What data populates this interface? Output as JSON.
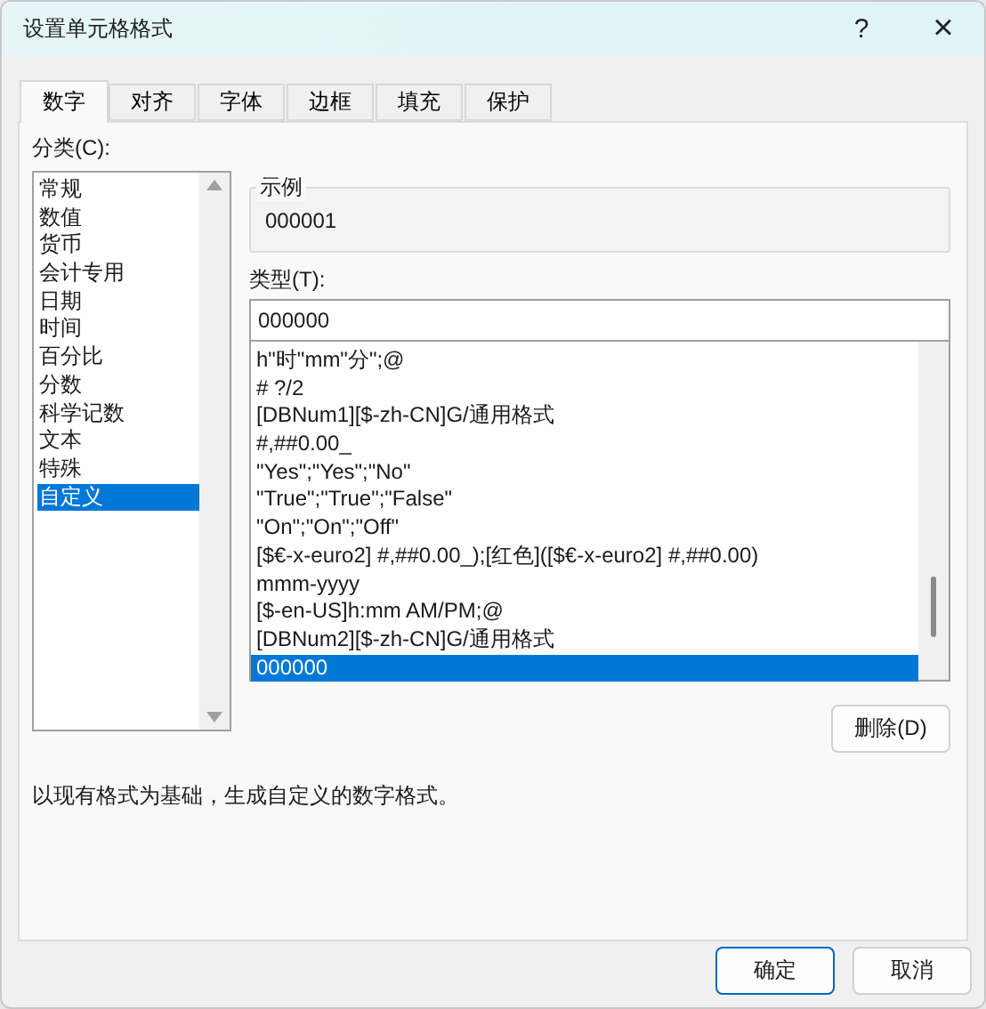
{
  "window": {
    "title": "设置单元格格式",
    "help": "?",
    "close": "×"
  },
  "tabs": [
    {
      "label": "数字",
      "selected": true
    },
    {
      "label": "对齐",
      "selected": false
    },
    {
      "label": "字体",
      "selected": false
    },
    {
      "label": "边框",
      "selected": false
    },
    {
      "label": "填充",
      "selected": false
    },
    {
      "label": "保护",
      "selected": false
    }
  ],
  "category": {
    "label": "分类(C):",
    "items": [
      {
        "label": "常规",
        "selected": false
      },
      {
        "label": "数值",
        "selected": false
      },
      {
        "label": "货币",
        "selected": false
      },
      {
        "label": "会计专用",
        "selected": false
      },
      {
        "label": "日期",
        "selected": false
      },
      {
        "label": "时间",
        "selected": false
      },
      {
        "label": "百分比",
        "selected": false
      },
      {
        "label": "分数",
        "selected": false
      },
      {
        "label": "科学记数",
        "selected": false
      },
      {
        "label": "文本",
        "selected": false
      },
      {
        "label": "特殊",
        "selected": false
      },
      {
        "label": "自定义",
        "selected": true
      }
    ]
  },
  "sample": {
    "label": "示例",
    "value": "000001"
  },
  "type": {
    "label": "类型(T):",
    "value": "000000",
    "items": [
      {
        "label": "h\"时\"mm\"分\";@",
        "selected": false
      },
      {
        "label": "# ?/2",
        "selected": false
      },
      {
        "label": "[DBNum1][$-zh-CN]G/通用格式",
        "selected": false
      },
      {
        "label": "#,##0.00_",
        "selected": false
      },
      {
        "label": "\"Yes\";\"Yes\";\"No\"",
        "selected": false
      },
      {
        "label": "\"True\";\"True\";\"False\"",
        "selected": false
      },
      {
        "label": "\"On\";\"On\";\"Off\"",
        "selected": false
      },
      {
        "label": "[$€-x-euro2] #,##0.00_);[红色]([$€-x-euro2] #,##0.00)",
        "selected": false
      },
      {
        "label": "mmm-yyyy",
        "selected": false
      },
      {
        "label": "[$-en-US]h:mm AM/PM;@",
        "selected": false
      },
      {
        "label": "[DBNum2][$-zh-CN]G/通用格式",
        "selected": false
      },
      {
        "label": "000000",
        "selected": true
      }
    ]
  },
  "delete_button": "删除(D)",
  "description": "以现有格式为基础，生成自定义的数字格式。",
  "buttons": [
    {
      "label": "确定",
      "kind": "primary"
    },
    {
      "label": "取消",
      "kind": "normal"
    }
  ]
}
